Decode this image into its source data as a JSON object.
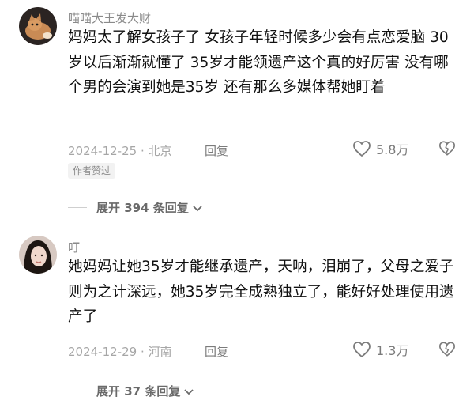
{
  "comments": [
    {
      "username": "喵喵大王发大财",
      "text": "妈妈太了解女孩子了 女孩子年轻时候多少会有点恋爱脑 30岁以后渐渐就懂了 35岁才能领遗产这个真的好厉害 没有哪个男的会演到她是35岁 还有那么多媒体帮她盯着",
      "date_location": "2024-12-25 · 北京",
      "reply_label": "回复",
      "likes": "5.8万",
      "badge": "作者赞过",
      "expand_label": "展开 394 条回复"
    },
    {
      "username": "叮",
      "text": "她妈妈让她35岁才能继承遗产，天呐，泪崩了，父母之爱子则为之计深远，她35岁完全成熟独立了，能好好处理使用遗产了",
      "date_location": "2024-12-29 · 河南",
      "reply_label": "回复",
      "likes": "1.3万",
      "expand_label": "展开 37 条回复"
    }
  ],
  "icons": {
    "heart": "heart-outline-icon",
    "dislike": "broken-heart-icon",
    "chevron": "chevron-down-icon"
  },
  "colors": {
    "text": "#111111",
    "muted": "#a6a6a6",
    "secondary": "#7b7b7b"
  }
}
